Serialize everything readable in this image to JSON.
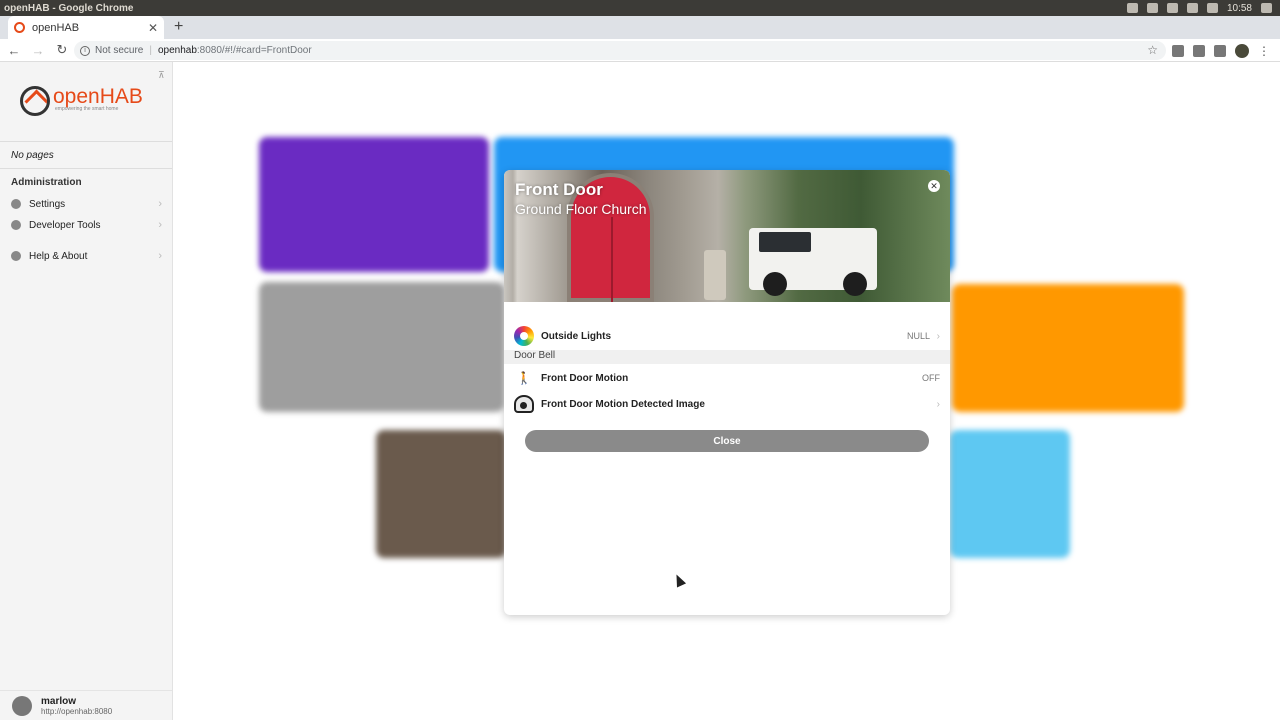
{
  "os": {
    "window_title": "openHAB - Google Chrome",
    "clock": "10:58"
  },
  "browser": {
    "tab_title": "openHAB",
    "not_secure": "Not secure",
    "url_host": "openhab",
    "url_rest": ":8080/#!/#card=FrontDoor"
  },
  "sidebar": {
    "logo_word": "openHAB",
    "logo_tagline": "empowering the smart home",
    "no_pages": "No pages",
    "admin_title": "Administration",
    "items": [
      {
        "label": "Settings",
        "icon": "gear-icon"
      },
      {
        "label": "Developer Tools",
        "icon": "shield-icon"
      },
      {
        "label": "Help & About",
        "icon": "help-icon"
      }
    ],
    "user": {
      "name": "marlow",
      "url": "http://openhab:8080"
    }
  },
  "modal": {
    "title": "Front Door",
    "subtitle": "Ground Floor Church",
    "rows": [
      {
        "label": "Outside Lights",
        "value": "NULL",
        "icon": "color-wheel-icon"
      },
      {
        "label": "Front Door Motion",
        "value": "OFF",
        "icon": "motion-icon"
      },
      {
        "label": "Front Door Motion Detected Image",
        "value": "",
        "icon": "camera-icon"
      }
    ],
    "group_title": "Door Bell",
    "close_label": "Close"
  },
  "colors": {
    "brand": "#e64a19",
    "card_purple": "#6a2bc2",
    "card_blue": "#2196f3",
    "card_grey": "#9e9e9e",
    "card_orange": "#ff9800",
    "card_light_blue": "#5ec8f2",
    "close_button": "#8a8a8a"
  }
}
